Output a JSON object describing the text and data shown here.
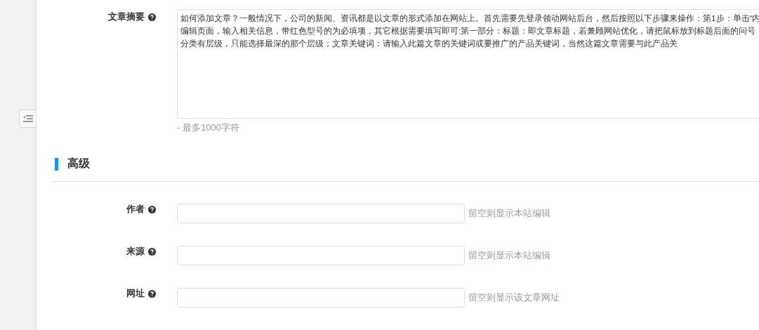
{
  "summary": {
    "label": "文章摘要",
    "lines": [
      "如何添加文章？一般情况下，公司的新闻、资讯都是以文章的形式添加在网站上。首先需要先登录领动网站后台，然后按照以下步骤来操作：第1步：单击“内",
      "编辑页面，输入相关信息，带红色型号的为必填项，其它根据需要填写即可:第一部分：标题：即文章标题，若兼顾网站优化，请把鼠标放到标题后面的问号",
      "分类有层级，只能选择最深的那个层级；文章关键词：请输入此篇文章的关键词或要推广的产品关键词，当然这篇文章需要与此产品关"
    ],
    "hint": "- 最多1000字符"
  },
  "section": {
    "title": "高级"
  },
  "fields": [
    {
      "label": "作者",
      "hint": "留空则显示本站编辑"
    },
    {
      "label": "来源",
      "hint": "留空则显示本站编辑"
    },
    {
      "label": "网址",
      "hint": "留空则显示该文章网址"
    }
  ]
}
